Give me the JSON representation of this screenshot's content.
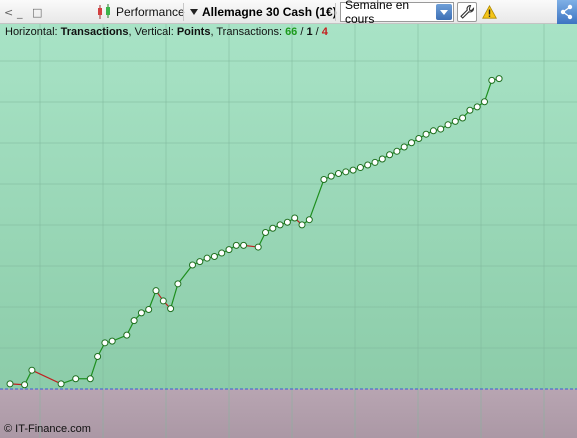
{
  "toolbar": {
    "window_controls": [
      "<",
      "_",
      "□"
    ],
    "performance_label": "Performance",
    "instrument": "Allemagne 30 Cash (1€)",
    "period_select": {
      "value": "Semaine en cours"
    },
    "icons": [
      "candlestick-icon",
      "caret-down-icon",
      "wrench-icon",
      "warning-icon",
      "share-icon"
    ]
  },
  "info": {
    "horizontal_label": "Horizontal:",
    "horizontal_value": "Transactions",
    "vertical_label": "Vertical:",
    "vertical_value": "Points",
    "transactions_label": "Transactions:",
    "total": "66",
    "slash1": " / ",
    "wins": "1",
    "slash2": " / ",
    "losses": "4"
  },
  "footer": {
    "copyright": "© IT-Finance.com"
  },
  "chart_data": {
    "type": "line",
    "xlabel": "Transactions",
    "ylabel": "Points",
    "grid": true,
    "colors": {
      "up": "#1e8f1e",
      "down": "#c02020",
      "baseline": "#3a5bd8",
      "positive_bg": "#a6e0c2",
      "negative_bg": "#b7a3b0"
    },
    "series": [
      {
        "points": [
          [
            2,
            0.6
          ],
          [
            4,
            0.5
          ],
          [
            5,
            2.2
          ],
          [
            9,
            0.6
          ],
          [
            11,
            1.2
          ],
          [
            13,
            1.2
          ],
          [
            14,
            3.8
          ],
          [
            15,
            5.4
          ],
          [
            16,
            5.6
          ],
          [
            18,
            6.3
          ],
          [
            19,
            8.0
          ],
          [
            20,
            8.9
          ],
          [
            21,
            9.3
          ],
          [
            22,
            11.5
          ],
          [
            23,
            10.3
          ],
          [
            24,
            9.4
          ],
          [
            25,
            12.3
          ],
          [
            27,
            14.5
          ],
          [
            28,
            14.9
          ],
          [
            29,
            15.3
          ],
          [
            30,
            15.5
          ],
          [
            31,
            15.9
          ],
          [
            32,
            16.3
          ],
          [
            33,
            16.8
          ],
          [
            34,
            16.8
          ],
          [
            36,
            16.6
          ],
          [
            37,
            18.3
          ],
          [
            38,
            18.8
          ],
          [
            39,
            19.2
          ],
          [
            40,
            19.5
          ],
          [
            41,
            20.0
          ],
          [
            42,
            19.2
          ],
          [
            43,
            19.8
          ],
          [
            45,
            24.5
          ],
          [
            46,
            24.9
          ],
          [
            47,
            25.2
          ],
          [
            48,
            25.4
          ],
          [
            49,
            25.6
          ],
          [
            50,
            25.9
          ],
          [
            51,
            26.2
          ],
          [
            52,
            26.5
          ],
          [
            53,
            26.9
          ],
          [
            54,
            27.4
          ],
          [
            55,
            27.8
          ],
          [
            56,
            28.3
          ],
          [
            57,
            28.8
          ],
          [
            58,
            29.3
          ],
          [
            59,
            29.8
          ],
          [
            60,
            30.2
          ],
          [
            61,
            30.4
          ],
          [
            62,
            30.9
          ],
          [
            63,
            31.3
          ],
          [
            64,
            31.7
          ],
          [
            65,
            32.6
          ],
          [
            66,
            33.0
          ],
          [
            67,
            33.6
          ],
          [
            68,
            36.1
          ],
          [
            69,
            36.3
          ]
        ]
      }
    ]
  }
}
